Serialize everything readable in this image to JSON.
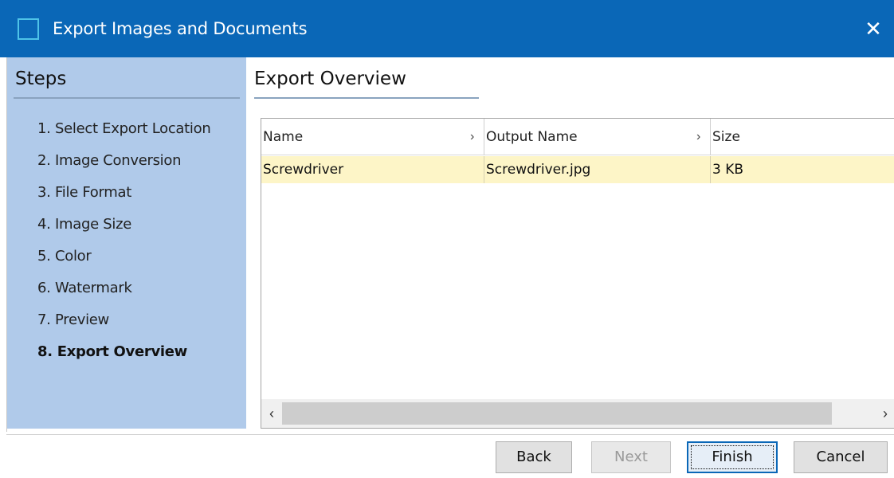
{
  "window": {
    "title": "Export Images and Documents",
    "close_glyph": "✕",
    "app_icon": "window-square-icon"
  },
  "steps": {
    "header": "Steps",
    "items": [
      {
        "label": "1. Select Export Location"
      },
      {
        "label": "2. Image Conversion"
      },
      {
        "label": "3. File Format"
      },
      {
        "label": "4. Image Size"
      },
      {
        "label": "5. Color"
      },
      {
        "label": "6. Watermark"
      },
      {
        "label": "7. Preview"
      },
      {
        "label": "8. Export Overview"
      }
    ],
    "active_index": 7
  },
  "content": {
    "title": "Export Overview",
    "table": {
      "columns": [
        {
          "label": "Name",
          "chevron": "›"
        },
        {
          "label": "Output Name",
          "chevron": "›"
        },
        {
          "label": "Size"
        }
      ],
      "rows": [
        {
          "name": "Screwdriver",
          "output_name": "Screwdriver.jpg",
          "size": "3 KB"
        }
      ]
    },
    "scrollbar": {
      "left_glyph": "‹",
      "right_glyph": "›"
    }
  },
  "buttons": {
    "back": "Back",
    "next": "Next",
    "finish": "Finish",
    "cancel": "Cancel"
  },
  "colors": {
    "titlebar": "#0a67b7",
    "steps_panel": "#b0caea",
    "selected_row": "#fdf5c7"
  }
}
